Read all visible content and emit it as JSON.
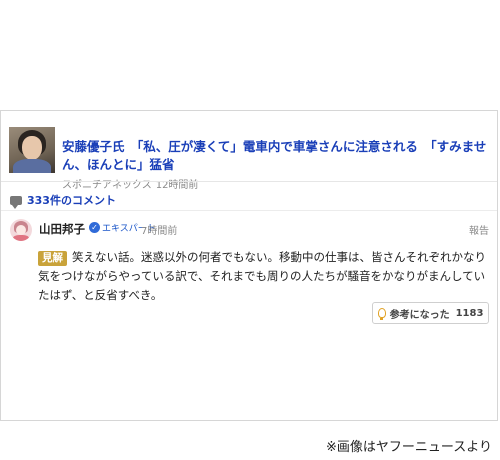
{
  "article": {
    "headline": "安藤優子氏　「私、圧が凄くて」電車内で車掌さんに注意される　「すみません、ほんとに」猛省",
    "source": "スポニチアネックス",
    "time": "12時間前"
  },
  "comments": {
    "count_label": "333件のコメント"
  },
  "comment": {
    "author": "山田邦子",
    "badge": "エキスパート",
    "time": "7時間前",
    "report": "報告",
    "tag": "見解",
    "text": "笑えない話。迷惑以外の何者でもない。移動中の仕事は、皆さんそれぞれかなり気をつけながらやっている訳で、それまでも周りの人たちが騒音をかなりがまんしていたはず、と反省すべき。",
    "helpful_label": "参考になった",
    "helpful_count": "1183"
  },
  "footer": {
    "credit": "※画像はヤフーニュースより"
  },
  "colors": {
    "link": "#1a3fb8",
    "tag": "#c9a33a",
    "expert": "#2f6ad8"
  },
  "icons": [
    "comment-bubble-icon",
    "verified-check-icon",
    "lightbulb-icon"
  ]
}
